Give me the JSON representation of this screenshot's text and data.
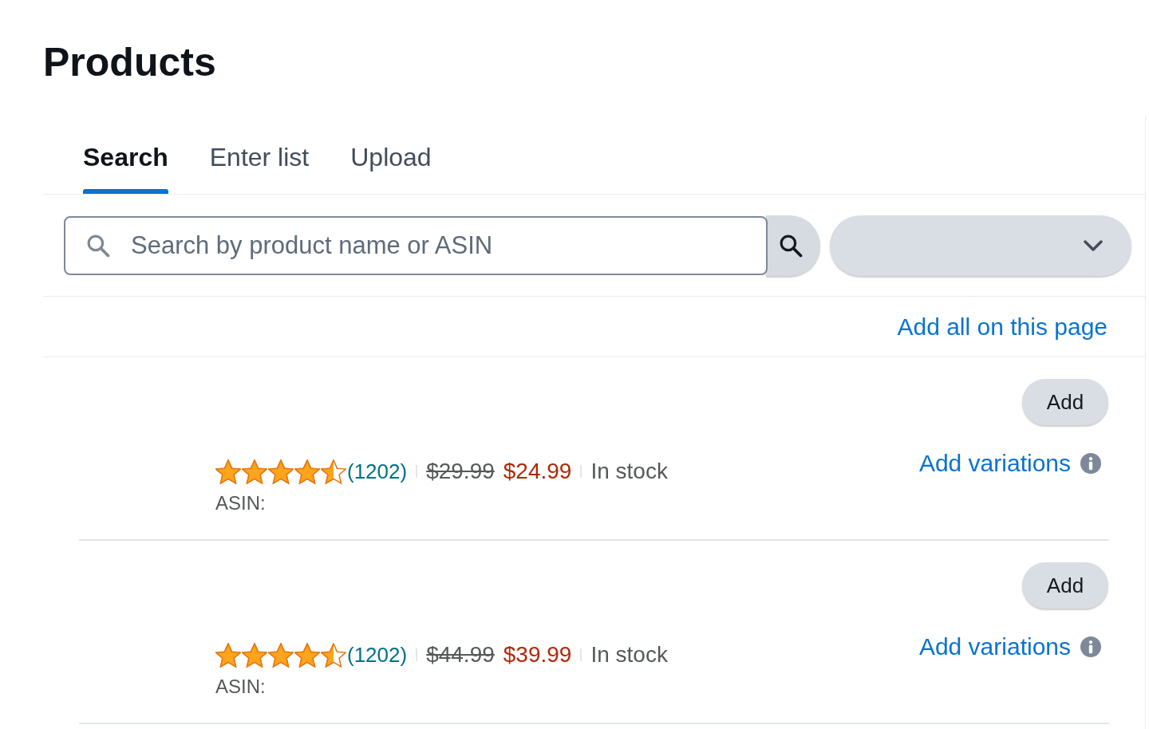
{
  "page": {
    "title": "Products"
  },
  "tabs": [
    {
      "label": "Search",
      "selected": true
    },
    {
      "label": "Enter list",
      "selected": false
    },
    {
      "label": "Upload",
      "selected": false
    }
  ],
  "search": {
    "placeholder": "Search by product name or ASIN"
  },
  "add_all_link": "Add all on this page",
  "products": [
    {
      "stars": 4.5,
      "review_count": "(1202)",
      "list_price": "$29.99",
      "price": "$24.99",
      "availability": "In stock",
      "asin_label": "ASIN:",
      "add_button": "Add",
      "variations_link": "Add variations"
    },
    {
      "stars": 4.5,
      "review_count": "(1202)",
      "list_price": "$44.99",
      "price": "$39.99",
      "availability": "In stock",
      "asin_label": "ASIN:",
      "add_button": "Add",
      "variations_link": "Add variations"
    }
  ]
}
